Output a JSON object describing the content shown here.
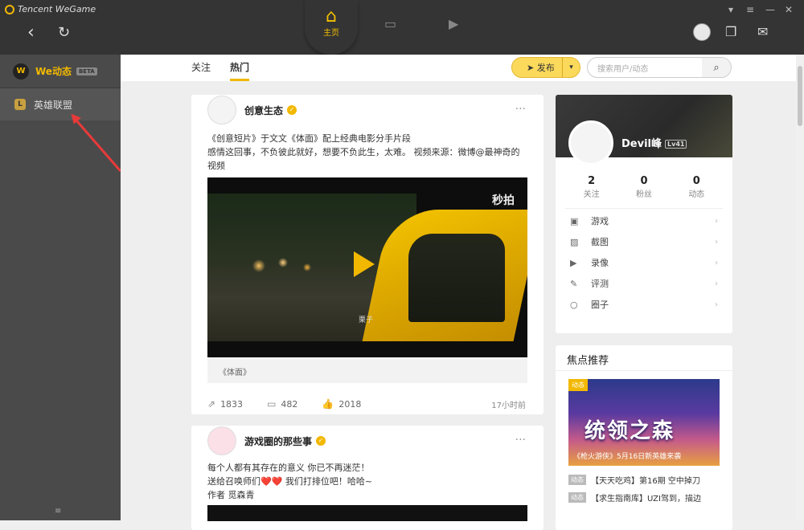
{
  "app": {
    "title": "Tencent WeGame",
    "home_label": "主页"
  },
  "sidebar": {
    "we_label": "We动态",
    "beta": "BETA",
    "lol_label": "英雄联盟"
  },
  "nav": {
    "follow": "关注",
    "hot": "热门",
    "publish": "发布",
    "search_placeholder": "搜索用户/动态"
  },
  "posts": [
    {
      "author": "创意生态",
      "text": "《创意短片》于文文《体面》配上经典电影分手片段",
      "text2": "感情这回事，不负彼此就好，想要不负此生，太难。 视频来源：微博@最神奇的视频",
      "video_logo": "秒拍",
      "video_sub": "栗子",
      "caption": "《体面》",
      "shares": "1833",
      "comments": "482",
      "likes": "2018",
      "time": "17小时前"
    },
    {
      "author": "游戏圈的那些事",
      "line1": "每个人都有其存在的意义 你已不再迷茫！",
      "line2": "送给召唤师们❤️❤️ 我们打排位吧！哈哈~",
      "line3": "作者 觅森青"
    }
  ],
  "profile": {
    "name": "Devil峰",
    "level": "Lv41",
    "stats": [
      {
        "value": "2",
        "label": "关注"
      },
      {
        "value": "0",
        "label": "粉丝"
      },
      {
        "value": "0",
        "label": "动态"
      }
    ],
    "menu": [
      {
        "label": "游戏",
        "icon": "game-icon"
      },
      {
        "label": "截图",
        "icon": "screenshot-icon"
      },
      {
        "label": "录像",
        "icon": "video-icon"
      },
      {
        "label": "评测",
        "icon": "review-icon"
      },
      {
        "label": "圈子",
        "icon": "circle-icon"
      }
    ]
  },
  "focus": {
    "title": "焦点推荐",
    "tag": "动态",
    "banner_text": "统领之森",
    "banner_caption": "《枪火游侠》5月16日新英雄来袭",
    "news": [
      {
        "tag": "动态",
        "text": "【天天吃鸡】第16期 空中掉刀"
      },
      {
        "tag": "动态",
        "text": "【求生指南库】UZI驾到，描边"
      }
    ]
  }
}
